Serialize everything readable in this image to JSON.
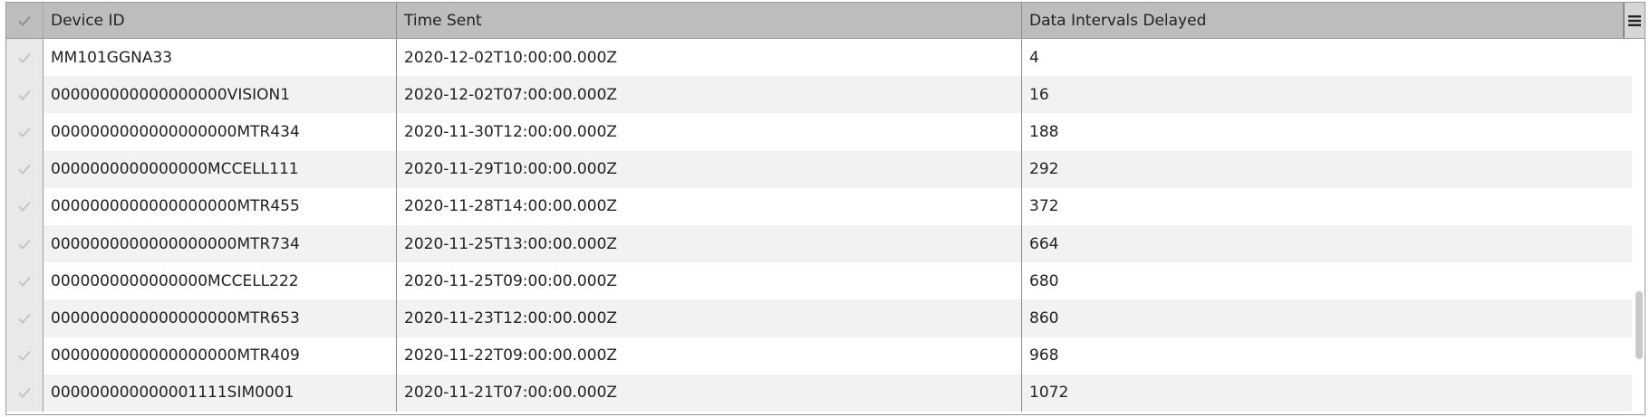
{
  "grid": {
    "columns": [
      {
        "key": "device_id",
        "label": "Device ID"
      },
      {
        "key": "time_sent",
        "label": "Time Sent"
      },
      {
        "key": "intervals_delayed",
        "label": "Data Intervals Delayed"
      }
    ],
    "rows": [
      {
        "device_id": "MM101GGNA33",
        "time_sent": "2020-12-02T10:00:00.000Z",
        "intervals_delayed": "4"
      },
      {
        "device_id": "000000000000000000VISION1",
        "time_sent": "2020-12-02T07:00:00.000Z",
        "intervals_delayed": "16"
      },
      {
        "device_id": "0000000000000000000MTR434",
        "time_sent": "2020-11-30T12:00:00.000Z",
        "intervals_delayed": "188"
      },
      {
        "device_id": "0000000000000000MCCELL111",
        "time_sent": "2020-11-29T10:00:00.000Z",
        "intervals_delayed": "292"
      },
      {
        "device_id": "0000000000000000000MTR455",
        "time_sent": "2020-11-28T14:00:00.000Z",
        "intervals_delayed": "372"
      },
      {
        "device_id": "0000000000000000000MTR734",
        "time_sent": "2020-11-25T13:00:00.000Z",
        "intervals_delayed": "664"
      },
      {
        "device_id": "0000000000000000MCCELL222",
        "time_sent": "2020-11-25T09:00:00.000Z",
        "intervals_delayed": "680"
      },
      {
        "device_id": "0000000000000000000MTR653",
        "time_sent": "2020-11-23T12:00:00.000Z",
        "intervals_delayed": "860"
      },
      {
        "device_id": "0000000000000000000MTR409",
        "time_sent": "2020-11-22T09:00:00.000Z",
        "intervals_delayed": "968"
      },
      {
        "device_id": "000000000000001111SIM0001",
        "time_sent": "2020-11-21T07:00:00.000Z",
        "intervals_delayed": "1072"
      }
    ],
    "scroll_position": 0.82,
    "scroll_visible_fraction": 0.18
  },
  "icons": {
    "select_all": "check-icon",
    "row_select": "check-icon",
    "menu": "hamburger-menu-icon"
  },
  "colors": {
    "header_bg": "#bdbdbd",
    "row_alt_bg": "#f2f2f2",
    "check_color": "#c4c4c4",
    "text": "#222222"
  }
}
